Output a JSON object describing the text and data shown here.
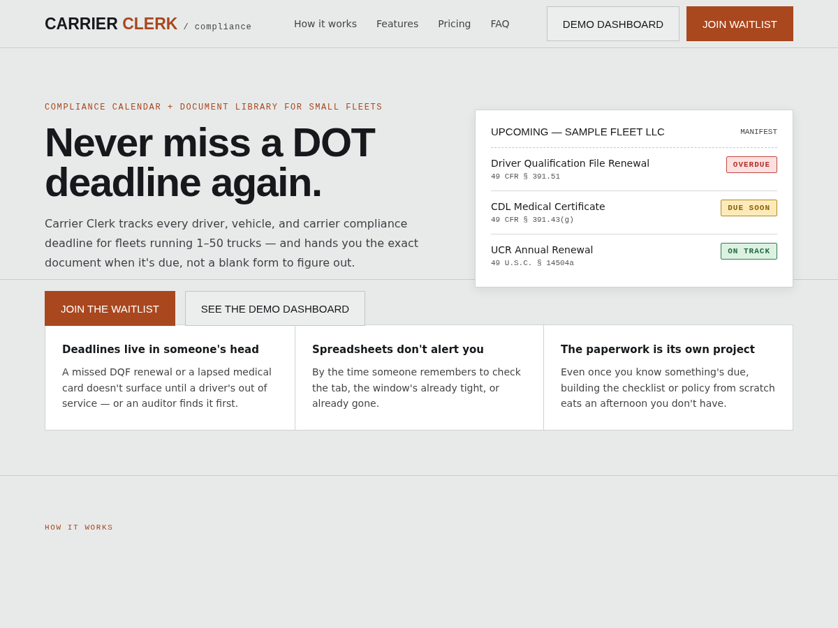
{
  "brand": {
    "word_1": "CARRIER",
    "word_2": "CLERK",
    "tagline": "/ compliance"
  },
  "nav": {
    "links": [
      "How it works",
      "Features",
      "Pricing",
      "FAQ"
    ],
    "buttons": [
      {
        "label": "DEMO DASHBOARD",
        "kind": "secondary"
      },
      {
        "label": "JOIN WAITLIST",
        "kind": "primary"
      }
    ]
  },
  "hero": {
    "eyebrow": "COMPLIANCE CALENDAR + DOCUMENT LIBRARY FOR SMALL FLEETS",
    "title": "Never miss a DOT deadline again.",
    "lead": "Carrier Clerk tracks every driver, vehicle, and carrier compliance deadline for fleets running 1–50 trucks — and hands you the exact document when it's due, not a blank form to figure out.",
    "buttons": [
      {
        "label": "JOIN THE WAITLIST",
        "kind": "primary"
      },
      {
        "label": "SEE THE DEMO DASHBOARD",
        "kind": "secondary"
      }
    ]
  },
  "manifest": {
    "title": "UPCOMING — SAMPLE FLEET LLC",
    "tag": "MANIFEST",
    "items": [
      {
        "name": "Driver Qualification File Renewal",
        "citation": "49 CFR § 391.51",
        "status": "OVERDUE",
        "kind": "overdue"
      },
      {
        "name": "CDL Medical Certificate",
        "citation": "49 CFR § 391.43(g)",
        "status": "DUE SOON",
        "kind": "due_soon"
      },
      {
        "name": "UCR Annual Renewal",
        "citation": "49 U.S.C. § 14504a",
        "status": "ON TRACK",
        "kind": "on_track"
      }
    ]
  },
  "problems": [
    {
      "title": "Deadlines live in someone's head",
      "text": "A missed DQF renewal or a lapsed medical card doesn't surface until a driver's out of service — or an auditor finds it first."
    },
    {
      "title": "Spreadsheets don't alert you",
      "text": "By the time someone remembers to check the tab, the window's already tight, or already gone."
    },
    {
      "title": "The paperwork is its own project",
      "text": "Even once you know something's due, building the checklist or policy from scratch eats an afternoon you don't have."
    }
  ],
  "next_section": {
    "eyebrow": "HOW IT WORKS"
  }
}
